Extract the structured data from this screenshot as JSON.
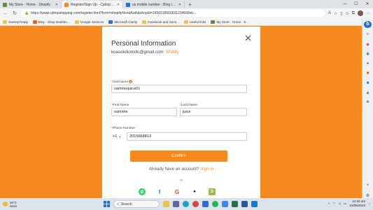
{
  "browser": {
    "tabs": [
      {
        "title": "My Store · Home · Shopify",
        "active": false,
        "favicon_color": "#5b8f3b"
      },
      {
        "title": "Register/Sign Up - Cjdropshipping",
        "active": true,
        "favicon_color": "#f7891f"
      },
      {
        "title": "us mobile number - Bing images",
        "active": false,
        "favicon_color": "#1f70e0"
      }
    ],
    "new_tab_icon": "plus-icon",
    "url": "https://www.cjdropshipping.com/register.html?from=shopifyNeedAuth&shopId=1656018560631234568sh...",
    "bookmarks": [
      {
        "label": "SweetyTreaty",
        "icon": "folder-icon"
      },
      {
        "label": "Etsy - Shop Dashbo...",
        "icon": "etsy-icon"
      },
      {
        "label": "Google Services",
        "icon": "folder-icon"
      },
      {
        "label": "Microsoft Clarity",
        "icon": "clarity-icon"
      },
      {
        "label": "Facebook and Servi...",
        "icon": "folder-icon"
      },
      {
        "label": "Useful links",
        "icon": "folder-icon"
      },
      {
        "label": "My Store · Home · S...",
        "icon": "shopify-icon"
      }
    ]
  },
  "modal": {
    "title": "Personal Information",
    "email": "koasolutionsllc@gmail.com",
    "modify_label": "Modify",
    "username_label": "Username",
    "username_value": "sammiejuice01",
    "first_name_label": "First Name",
    "first_name_value": "sammie",
    "last_name_label": "Last Name",
    "last_name_value": "juice",
    "phone_label": "Phone Number",
    "phone_prefix": "+1",
    "phone_value": "2015668813",
    "confirm_label": "Confirm",
    "signin_prompt": "Already have an account?",
    "signin_link": "Sign in",
    "or_label": "or",
    "social_icons": [
      "whatsapp-icon",
      "facebook-icon",
      "google-icon",
      "apple-icon",
      "shopify-icon"
    ],
    "required_mark": "*"
  },
  "taskbar": {
    "weather_temp": "26°C",
    "weather_desc": "Haze",
    "search_placeholder": "Search",
    "time": "12:33 am",
    "date": "10/05/2023"
  },
  "colors": {
    "accent": "#f7891f",
    "background": "#f7891f",
    "required": "#ee3333"
  }
}
